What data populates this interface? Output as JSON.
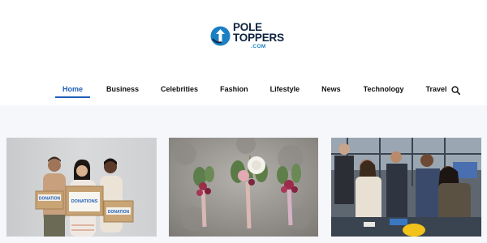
{
  "logo": {
    "line1": "POLE",
    "line2": "TOPPERS",
    "line3": ".COM"
  },
  "nav": {
    "items": [
      {
        "label": "Home",
        "active": true
      },
      {
        "label": "Business",
        "active": false
      },
      {
        "label": "Celebrities",
        "active": false
      },
      {
        "label": "Fashion",
        "active": false
      },
      {
        "label": "Lifestyle",
        "active": false
      },
      {
        "label": "News",
        "active": false
      },
      {
        "label": "Technology",
        "active": false
      },
      {
        "label": "Travel",
        "active": false
      }
    ],
    "search_icon": "search-icon"
  },
  "articles": [
    {
      "image": "volunteers-with-donation-boxes",
      "box_labels": [
        "DONATION",
        "DONATIONS",
        "DONATION"
      ]
    },
    {
      "image": "wedding-boutonnieres"
    },
    {
      "image": "team-meeting-in-office"
    }
  ],
  "colors": {
    "accent": "#1f5fb8",
    "logo_dark": "#0f2340",
    "logo_blue": "#1a7fc4",
    "band": "#f6f7fb"
  }
}
